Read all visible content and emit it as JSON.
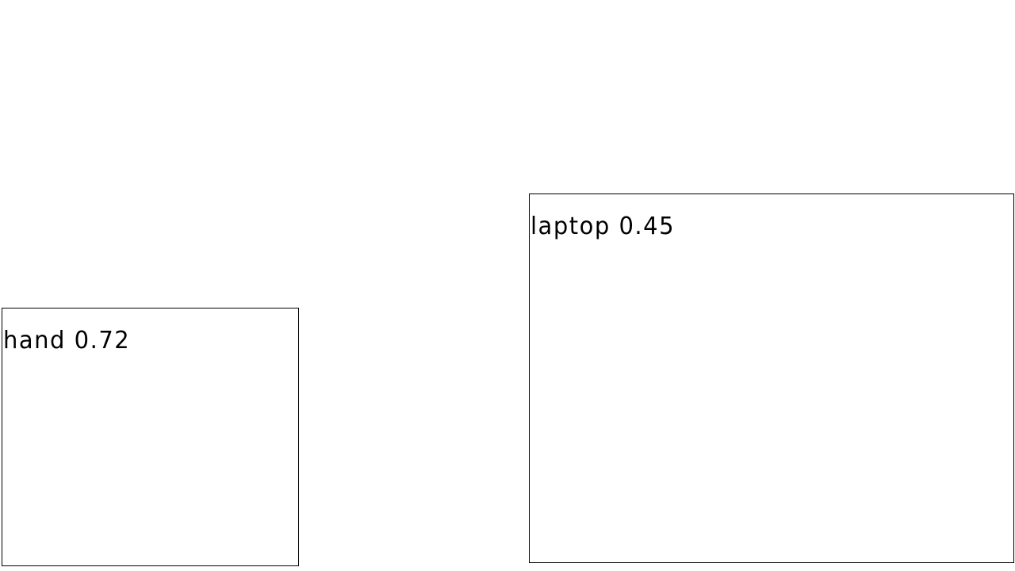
{
  "detections": [
    {
      "label": "hand 0.72",
      "class": "hand",
      "score": 0.72
    },
    {
      "label": "laptop 0.45",
      "class": "laptop",
      "score": 0.45
    }
  ],
  "colors": {
    "background": "#ffffff",
    "box_stroke": "#000000",
    "label_text": "#000000"
  }
}
